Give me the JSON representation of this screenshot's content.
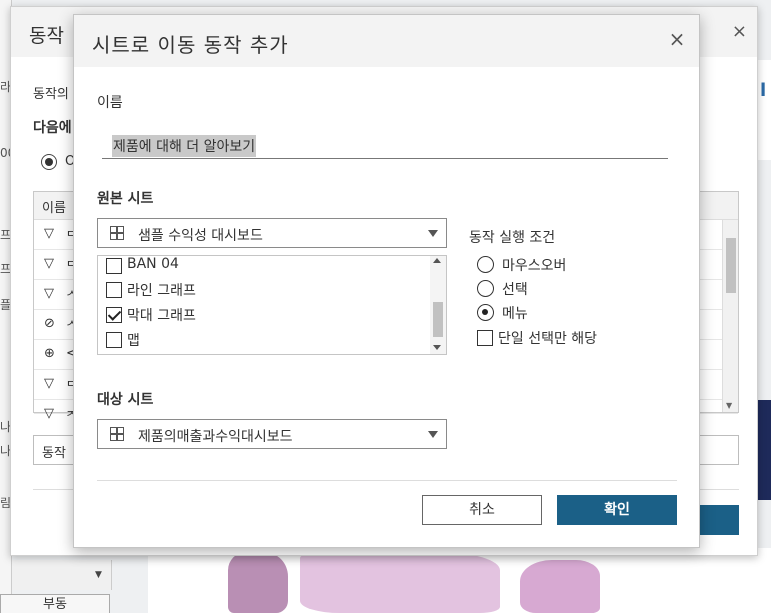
{
  "background": {
    "left_labels": [
      "라",
      "00",
      "프",
      "프",
      "플",
      "나",
      "나",
      "림"
    ],
    "bottom_button": "부동",
    "right_strip_text": "l",
    "top_snow": "❄"
  },
  "under_dialog": {
    "title": "동작",
    "close": "×",
    "label_1": "동작의",
    "label_2": "다음에",
    "radio_text": "O",
    "table_header": "이름",
    "rows": [
      {
        "icon": "▽",
        "text": "ᄃ"
      },
      {
        "icon": "▽",
        "text": "ᄃ"
      },
      {
        "icon": "▽",
        "text": "ᄉ"
      },
      {
        "icon": "⊘",
        "text": "ᄉ"
      },
      {
        "icon": "⊕",
        "text": "<"
      },
      {
        "icon": "▽",
        "text": "ᄃ"
      },
      {
        "icon": "▽",
        "text": "ᄌ"
      }
    ],
    "input_text": "동작"
  },
  "dialog": {
    "title": "시트로 이동 동작 추가",
    "close": "×",
    "name_label": "이름",
    "name_value": "제품에 대해 더 알아보기",
    "source_label": "원본 시트",
    "source_dropdown": "샘플 수익성 대시보드",
    "sheets": [
      {
        "label": "BAN 04",
        "checked": false
      },
      {
        "label": "라인 그래프",
        "checked": false
      },
      {
        "label": "막대 그래프",
        "checked": true
      },
      {
        "label": "맵",
        "checked": false
      }
    ],
    "condition_label": "동작 실행 조건",
    "conditions": [
      {
        "label": "마우스오버",
        "selected": false
      },
      {
        "label": "선택",
        "selected": false
      },
      {
        "label": "메뉴",
        "selected": true
      }
    ],
    "single_select_label": "단일 선택만 해당",
    "target_label": "대상 시트",
    "target_dropdown": "제품의매출과수익대시보드",
    "cancel_label": "취소",
    "ok_label": "확인"
  },
  "colors": {
    "primary_button": "#1b6087"
  }
}
